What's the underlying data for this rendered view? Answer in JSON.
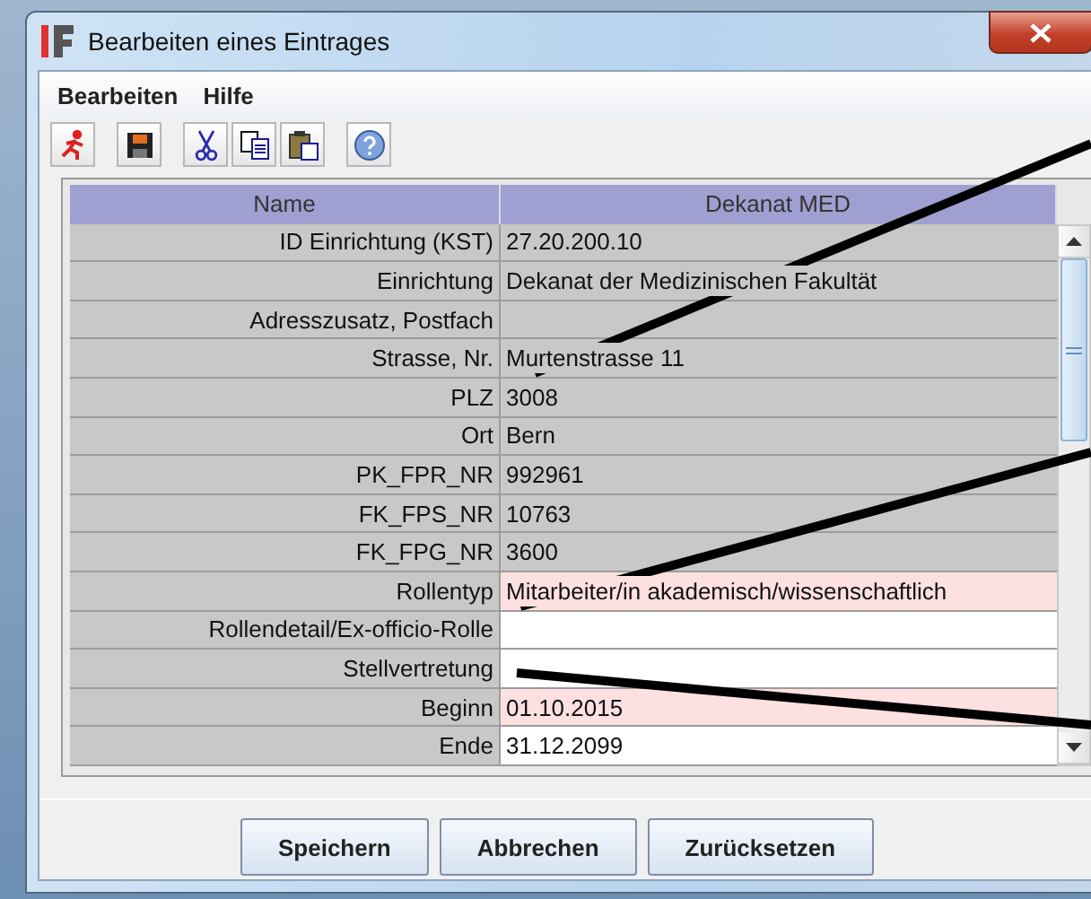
{
  "window": {
    "title": "Bearbeiten eines Eintrages"
  },
  "menu": [
    "Bearbeiten",
    "Hilfe"
  ],
  "toolbar": [
    {
      "kind": "exit"
    },
    {
      "kind": "save"
    },
    {
      "kind": "cut"
    },
    {
      "kind": "copy"
    },
    {
      "kind": "paste"
    },
    {
      "kind": "help"
    }
  ],
  "table": {
    "columns": [
      "Name",
      "Dekanat MED"
    ],
    "rows": [
      {
        "name": "ID Einrichtung (KST)",
        "value": "27.20.200.10",
        "kind": "readonly"
      },
      {
        "name": "Einrichtung",
        "value": "Dekanat der Medizinischen Fakultät",
        "kind": "readonly"
      },
      {
        "name": "Adresszusatz, Postfach",
        "value": "",
        "kind": "readonly"
      },
      {
        "name": "Strasse, Nr.",
        "value": "Murtenstrasse 11",
        "kind": "readonly"
      },
      {
        "name": "PLZ",
        "value": "3008",
        "kind": "readonly"
      },
      {
        "name": "Ort",
        "value": "Bern",
        "kind": "readonly"
      },
      {
        "name": "PK_FPR_NR",
        "value": "992961",
        "kind": "readonly"
      },
      {
        "name": "FK_FPS_NR",
        "value": "10763",
        "kind": "readonly"
      },
      {
        "name": "FK_FPG_NR",
        "value": "3600",
        "kind": "readonly"
      },
      {
        "name": "Rollentyp",
        "value": "Mitarbeiter/in akademisch/wissenschaftlich",
        "kind": "required"
      },
      {
        "name": "Rollendetail/Ex-officio-Rolle",
        "value": "",
        "kind": "editable"
      },
      {
        "name": "Stellvertretung",
        "value": "",
        "kind": "editable"
      },
      {
        "name": "Beginn",
        "value": "01.10.2015",
        "kind": "required"
      },
      {
        "name": "Ende",
        "value": "31.12.2099",
        "kind": "editable"
      }
    ]
  },
  "buttons": [
    "Speichern",
    "Abbrechen",
    "Zurücksetzen"
  ]
}
